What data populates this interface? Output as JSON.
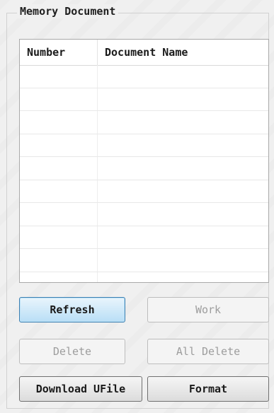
{
  "group": {
    "title": "Memory Document"
  },
  "list": {
    "columns": [
      "Number",
      "Document Name"
    ],
    "rows": [
      {
        "number": "",
        "name": ""
      },
      {
        "number": "",
        "name": ""
      },
      {
        "number": "",
        "name": ""
      },
      {
        "number": "",
        "name": ""
      },
      {
        "number": "",
        "name": ""
      },
      {
        "number": "",
        "name": ""
      },
      {
        "number": "",
        "name": ""
      },
      {
        "number": "",
        "name": ""
      },
      {
        "number": "",
        "name": ""
      }
    ]
  },
  "buttons": {
    "refresh": {
      "label": "Refresh",
      "state": "focused"
    },
    "work": {
      "label": "Work",
      "state": "disabled"
    },
    "delete": {
      "label": "Delete",
      "state": "disabled"
    },
    "all_delete": {
      "label": "All Delete",
      "state": "disabled"
    },
    "download_ufile": {
      "label": "Download UFile",
      "state": "enabled"
    },
    "format": {
      "label": "Format",
      "state": "enabled"
    }
  },
  "colors": {
    "window_bg": "#f0f0f0",
    "focus_border": "#3c7fb1",
    "disabled_text": "#9d9d9d"
  }
}
